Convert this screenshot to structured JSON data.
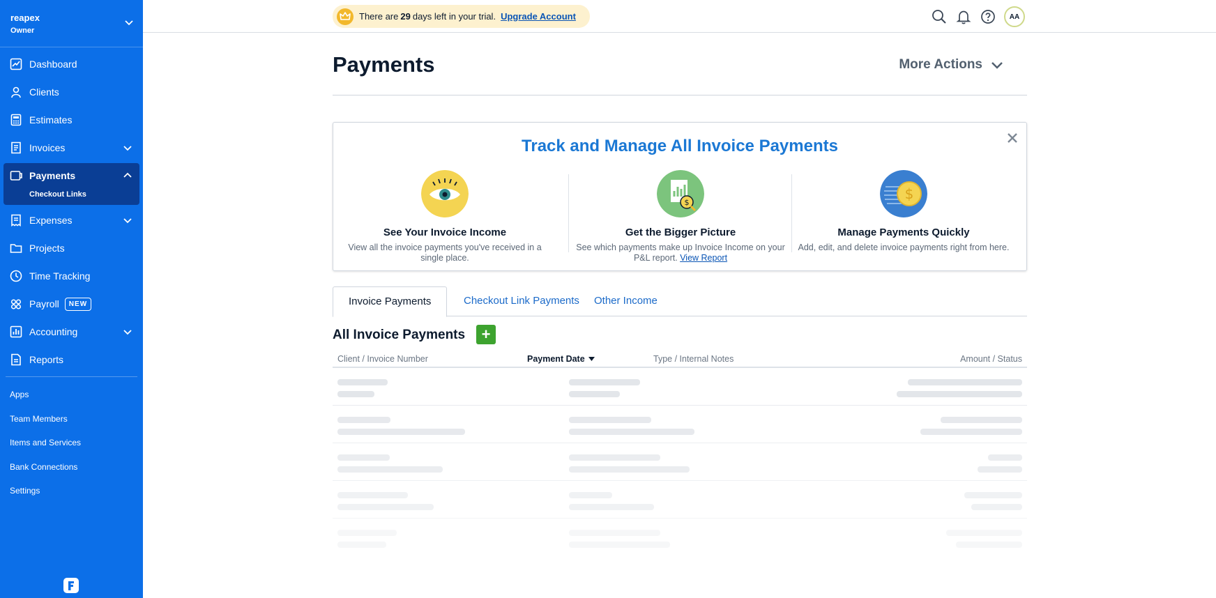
{
  "account": {
    "name": "reapex",
    "role": "Owner"
  },
  "nav": {
    "dashboard": "Dashboard",
    "clients": "Clients",
    "estimates": "Estimates",
    "invoices": "Invoices",
    "payments": "Payments",
    "checkout_links": "Checkout Links",
    "expenses": "Expenses",
    "projects": "Projects",
    "time_tracking": "Time Tracking",
    "payroll": "Payroll",
    "payroll_badge": "NEW",
    "accounting": "Accounting",
    "reports": "Reports"
  },
  "secondary_nav": [
    "Apps",
    "Team Members",
    "Items and Services",
    "Bank Connections",
    "Settings"
  ],
  "trial": {
    "prefix": "There are",
    "days": "29",
    "suffix": "days left in your trial.",
    "upgrade": "Upgrade Account"
  },
  "user": {
    "initials": "AA"
  },
  "page": {
    "title": "Payments",
    "more_actions": "More Actions"
  },
  "promo": {
    "title": "Track and Manage All Invoice Payments",
    "features": [
      {
        "title": "See Your Invoice Income",
        "desc": "View all the invoice payments you've received in a single place."
      },
      {
        "title": "Get the Bigger Picture",
        "desc": "See which payments make up Invoice Income on your P&L report.",
        "link": "View Report"
      },
      {
        "title": "Manage Payments Quickly",
        "desc": "Add, edit, and delete invoice payments right from here."
      }
    ]
  },
  "tabs": [
    "Invoice Payments",
    "Checkout Link Payments",
    "Other Income"
  ],
  "section": {
    "title": "All Invoice Payments",
    "add": "+"
  },
  "table": {
    "columns": [
      "Client / Invoice Number",
      "Payment Date",
      "Type / Internal Notes",
      "Amount / Status"
    ]
  },
  "colors": {
    "sidebar": "#0c6fe8",
    "sidebar_active": "#0a3e95",
    "accent": "#1b78d4",
    "add": "#3da32f",
    "trial_bg": "#fdf1cf"
  }
}
